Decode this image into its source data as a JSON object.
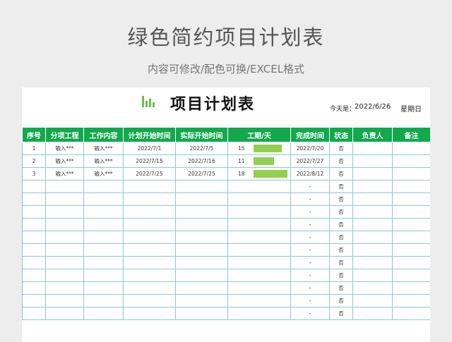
{
  "page": {
    "title": "绿色简约项目计划表",
    "subtitle": "内容可修改/配色可换/EXCEL格式"
  },
  "sheet": {
    "title": "项目计划表",
    "date_label": "今天是：",
    "date": "2022/6/26",
    "weekday": "星期日",
    "accent_color": "#12a84d",
    "bar_color": "#92d050",
    "columns": [
      "序号",
      "分项工程",
      "工作内容",
      "计划开始时间",
      "实际开始时间",
      "工期/天",
      "完成时间",
      "状态",
      "负责人",
      "备注"
    ],
    "rows": [
      {
        "no": "1",
        "project": "输入***",
        "content": "输入***",
        "plan_start": "2022/7/1",
        "actual_start": "2022/7/5",
        "days": "15",
        "finish": "2022/7/20",
        "status": "否",
        "owner": "",
        "note": ""
      },
      {
        "no": "2",
        "project": "输入***",
        "content": "输入***",
        "plan_start": "2022/7/15",
        "actual_start": "2022/7/16",
        "days": "11",
        "finish": "2022/7/27",
        "status": "否",
        "owner": "",
        "note": ""
      },
      {
        "no": "3",
        "project": "输入***",
        "content": "输入***",
        "plan_start": "2022/7/25",
        "actual_start": "2022/7/25",
        "days": "18",
        "finish": "2022/8/12",
        "status": "否",
        "owner": "",
        "note": ""
      },
      {
        "no": "",
        "project": "",
        "content": "",
        "plan_start": "",
        "actual_start": "",
        "days": "",
        "finish": "-",
        "status": "否",
        "owner": "",
        "note": ""
      },
      {
        "no": "",
        "project": "",
        "content": "",
        "plan_start": "",
        "actual_start": "",
        "days": "",
        "finish": "-",
        "status": "否",
        "owner": "",
        "note": ""
      },
      {
        "no": "",
        "project": "",
        "content": "",
        "plan_start": "",
        "actual_start": "",
        "days": "",
        "finish": "-",
        "status": "否",
        "owner": "",
        "note": ""
      },
      {
        "no": "",
        "project": "",
        "content": "",
        "plan_start": "",
        "actual_start": "",
        "days": "",
        "finish": "-",
        "status": "否",
        "owner": "",
        "note": ""
      },
      {
        "no": "",
        "project": "",
        "content": "",
        "plan_start": "",
        "actual_start": "",
        "days": "",
        "finish": "-",
        "status": "否",
        "owner": "",
        "note": ""
      },
      {
        "no": "",
        "project": "",
        "content": "",
        "plan_start": "",
        "actual_start": "",
        "days": "",
        "finish": "-",
        "status": "否",
        "owner": "",
        "note": ""
      },
      {
        "no": "",
        "project": "",
        "content": "",
        "plan_start": "",
        "actual_start": "",
        "days": "",
        "finish": "-",
        "status": "否",
        "owner": "",
        "note": ""
      },
      {
        "no": "",
        "project": "",
        "content": "",
        "plan_start": "",
        "actual_start": "",
        "days": "",
        "finish": "-",
        "status": "否",
        "owner": "",
        "note": ""
      },
      {
        "no": "",
        "project": "",
        "content": "",
        "plan_start": "",
        "actual_start": "",
        "days": "",
        "finish": "-",
        "status": "否",
        "owner": "",
        "note": ""
      },
      {
        "no": "",
        "project": "",
        "content": "",
        "plan_start": "",
        "actual_start": "",
        "days": "",
        "finish": "-",
        "status": "否",
        "owner": "",
        "note": ""
      },
      {
        "no": "",
        "project": "",
        "content": "",
        "plan_start": "",
        "actual_start": "",
        "days": "",
        "finish": "-",
        "status": "否",
        "owner": "",
        "note": ""
      }
    ]
  }
}
